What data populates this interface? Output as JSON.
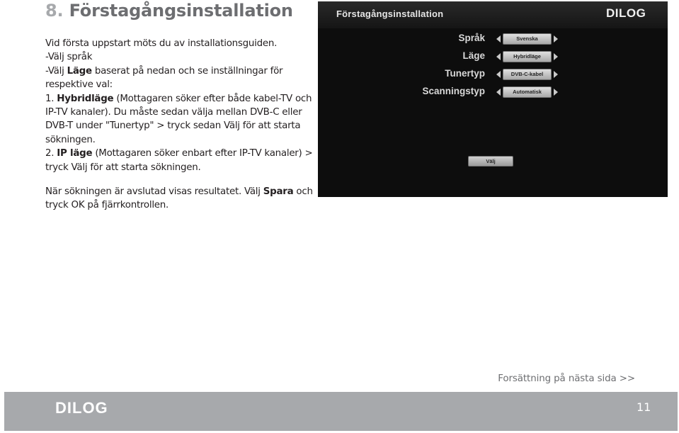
{
  "heading": {
    "number": "8.",
    "title": "Förstagångsinstallation"
  },
  "instructions": {
    "intro": "Vid första uppstart möts du av installationsguiden.",
    "step_language": "-Välj språk",
    "step_mode_prefix": "-Välj ",
    "step_mode_bold": "Läge",
    "step_mode_suffix": " baserat på nedan och se inställningar för respektive val:",
    "option1_prefix": "1. ",
    "option1_bold": "Hybridläge",
    "option1_text": " (Mottagaren söker efter både kabel-TV och IP-TV kanaler). Du måste sedan välja mellan DVB-C eller DVB-T under \"Tunertyp\" > tryck sedan Välj för att starta sökningen.",
    "option2_prefix": "2. ",
    "option2_bold": "IP läge",
    "option2_text": " (Mottagaren söker enbart efter IP-TV kanaler) > tryck Välj för att starta sökningen.",
    "finish_prefix": "När sökningen är avslutad visas resultatet. Välj ",
    "finish_bold": "Spara",
    "finish_suffix": " och tryck OK på fjärrkontrollen."
  },
  "screenshot": {
    "title": "Förstagångsinstallation",
    "logo": "DILOG",
    "rows": [
      {
        "label": "Språk",
        "value": "Svenska"
      },
      {
        "label": "Läge",
        "value": "Hybridläge"
      },
      {
        "label": "Tunertyp",
        "value": "DVB-C-kabel"
      },
      {
        "label": "Scanningstyp",
        "value": "Automatisk"
      }
    ],
    "button": "Välj"
  },
  "continue_note": "Forsättning på nästa sida >>",
  "footer": {
    "logo": "DILOG",
    "page_number": "11"
  },
  "colors": {
    "heading_number": "#a7a9ac",
    "heading_text": "#6d6e71",
    "footer_bar": "#a7a9ac"
  }
}
